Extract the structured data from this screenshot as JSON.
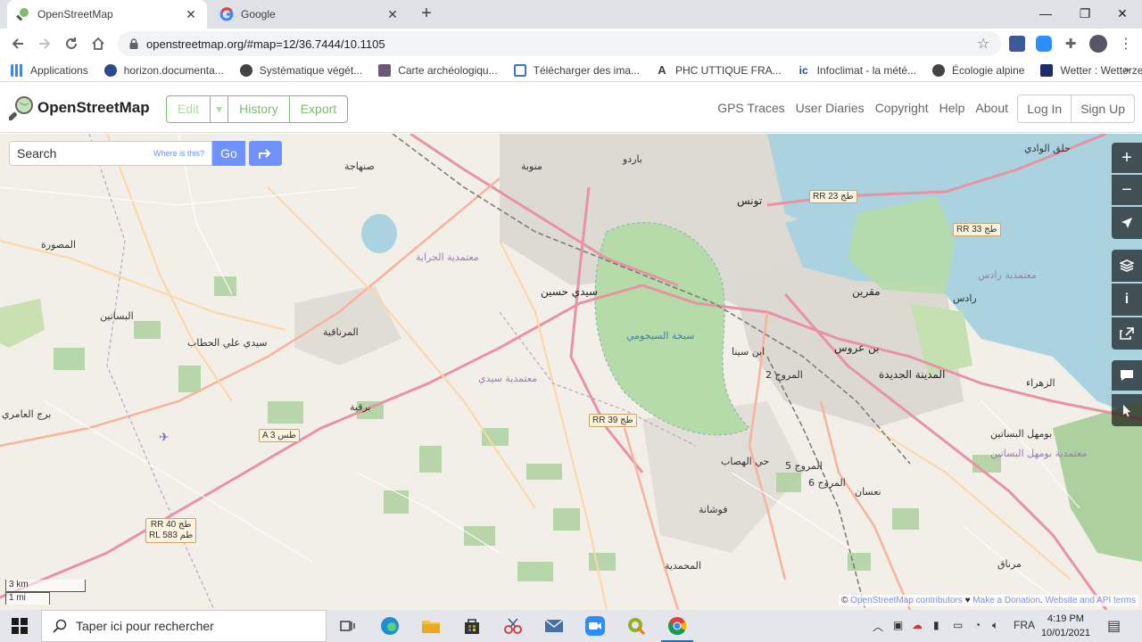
{
  "browser": {
    "tabs": [
      {
        "title": "OpenStreetMap",
        "icon": "osm-favicon",
        "active": true
      },
      {
        "title": "Google",
        "icon": "google-favicon",
        "active": false
      }
    ],
    "url": "openstreetmap.org/#map=12/36.7444/10.1105",
    "bookmarks": [
      {
        "label": "Applications",
        "icon": "apps-grid-icon"
      },
      {
        "label": "horizon.documenta...",
        "icon": "horizon-icon"
      },
      {
        "label": "Systématique végét...",
        "icon": "globe-icon"
      },
      {
        "label": "Carte archéologiqu...",
        "icon": "map-thumb-icon"
      },
      {
        "label": "Télécharger des ima...",
        "icon": "window-icon"
      },
      {
        "label": "PHC UTTIQUE FRA...",
        "icon": "letter-a-icon"
      },
      {
        "label": "Infoclimat - la mété...",
        "icon": "infoclimat-icon"
      },
      {
        "label": "Écologie alpine",
        "icon": "globe-icon"
      },
      {
        "label": "Wetter : Wetterzent...",
        "icon": "wetter-icon"
      }
    ]
  },
  "osm": {
    "brand": "OpenStreetMap",
    "edit_buttons": {
      "edit": "Edit",
      "caret": "▾",
      "history": "History",
      "export": "Export"
    },
    "nav_links": [
      "GPS Traces",
      "User Diaries",
      "Copyright",
      "Help",
      "About"
    ],
    "auth": {
      "login": "Log In",
      "signup": "Sign Up"
    },
    "search": {
      "placeholder": "Search",
      "where": "Where is this?",
      "go": "Go"
    },
    "scale": {
      "km": "3 km",
      "mi": "1 mi"
    },
    "attribution": {
      "prefix": "© ",
      "osm": "OpenStreetMap contributors",
      "heart": " ♥ ",
      "donate": "Make a Donation",
      "sep": ". ",
      "terms": "Website and API terms"
    }
  },
  "map_labels": [
    {
      "text": "تونس",
      "cls": "big"
    },
    {
      "text": "سيدي حسين",
      "cls": "big"
    },
    {
      "text": "سيدي علي الحطاب",
      "cls": ""
    },
    {
      "text": "بن عروس",
      "cls": "big"
    },
    {
      "text": "المدينة الجديدة",
      "cls": "big"
    },
    {
      "text": "مقرين",
      "cls": "big"
    },
    {
      "text": "رادس",
      "cls": ""
    },
    {
      "text": "الزهراء",
      "cls": ""
    },
    {
      "text": "حلق الوادي",
      "cls": ""
    },
    {
      "text": "باردو",
      "cls": ""
    },
    {
      "text": "منوبة",
      "cls": ""
    },
    {
      "text": "المحمدية",
      "cls": ""
    },
    {
      "text": "فوشانة",
      "cls": ""
    },
    {
      "text": "نعسان",
      "cls": ""
    },
    {
      "text": "سبخة السيجومي",
      "cls": "blue"
    },
    {
      "text": "معتمدية الجرابة",
      "cls": "purple"
    },
    {
      "text": "معتمدية سيدي",
      "cls": "purple"
    },
    {
      "text": "معتمدية رادس",
      "cls": "purple"
    },
    {
      "text": "معتمدية بومهل البساتين",
      "cls": "purple"
    },
    {
      "text": "بومهل البساتين",
      "cls": ""
    },
    {
      "text": "مرناق",
      "cls": ""
    },
    {
      "text": "برج العامري",
      "cls": ""
    },
    {
      "text": "المرناقية",
      "cls": ""
    },
    {
      "text": "البساتين",
      "cls": ""
    },
    {
      "text": "المصورة",
      "cls": ""
    },
    {
      "text": "صنهاجة",
      "cls": ""
    },
    {
      "text": "برقية",
      "cls": ""
    },
    {
      "text": "ابن سينا",
      "cls": ""
    },
    {
      "text": "المروج 2",
      "cls": ""
    },
    {
      "text": "المروج 5",
      "cls": ""
    },
    {
      "text": "المروج 6",
      "cls": ""
    },
    {
      "text": "حي الهصاب",
      "cls": ""
    }
  ],
  "road_shields": [
    {
      "text": "RR 23 طج"
    },
    {
      "text": "RR 33 طج"
    },
    {
      "text": "RR 39 طج"
    },
    {
      "text": "A 3 طس"
    },
    {
      "text": "RR 40 طج"
    },
    {
      "text": "RL 583 طم"
    }
  ],
  "taskbar": {
    "search_placeholder": "Taper ici pour rechercher",
    "lang": "FRA",
    "time": "4:19 PM",
    "date": "10/01/2021"
  },
  "colors": {
    "osm_green": "#7ebc6f",
    "osm_blue": "#7092ff",
    "water": "#aad3df",
    "wetland": "#a4d6a0"
  }
}
